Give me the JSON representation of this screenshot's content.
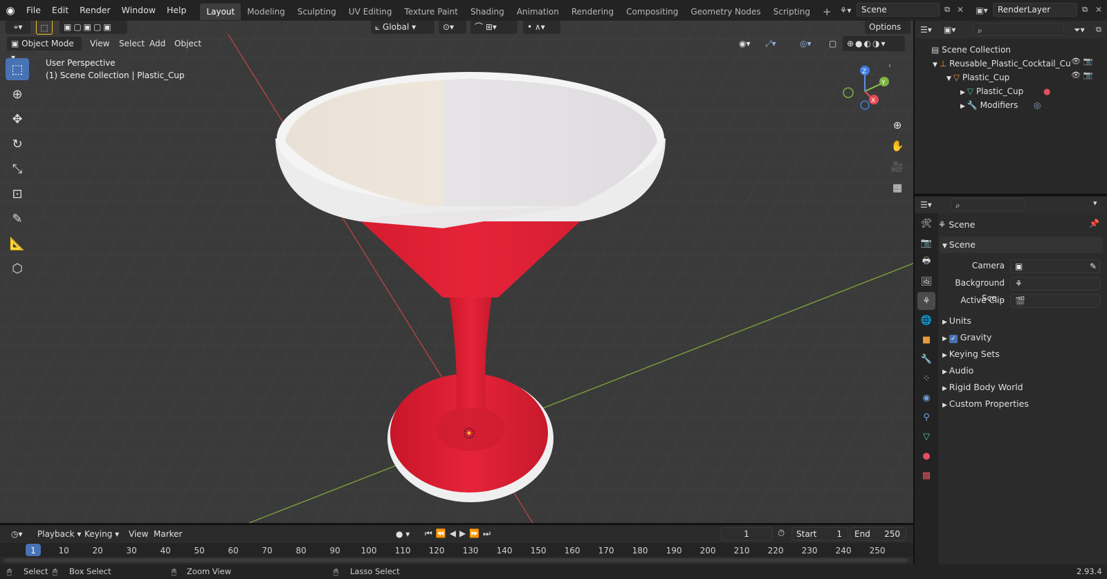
{
  "menubar": {
    "logo_icon": "blender-logo-icon",
    "items": [
      "File",
      "Edit",
      "Render",
      "Window",
      "Help"
    ]
  },
  "workspace_tabs": [
    "Layout",
    "Modeling",
    "Sculpting",
    "UV Editing",
    "Texture Paint",
    "Shading",
    "Animation",
    "Rendering",
    "Compositing",
    "Geometry Nodes",
    "Scripting"
  ],
  "active_workspace": "Layout",
  "add_tab_label": "+",
  "scene_selector": {
    "value": "Scene"
  },
  "viewlayer_selector": {
    "value": "RenderLayer"
  },
  "viewport": {
    "mode": "Object Mode",
    "menus": [
      "View",
      "Select",
      "Add",
      "Object"
    ],
    "transform_orientation": "Global",
    "options_label": "Options",
    "overlay_line1": "User Perspective",
    "overlay_line2": "(1) Scene Collection | Plastic_Cup",
    "gizmo_axes": [
      "Z",
      "Y",
      "X"
    ]
  },
  "outliner": {
    "root": "Scene Collection",
    "items": [
      {
        "label": "Reusable_Plastic_Cocktail_Cu",
        "level": 1
      },
      {
        "label": "Plastic_Cup",
        "level": 2
      },
      {
        "label": "Plastic_Cup",
        "level": 3
      },
      {
        "label": "Modifiers",
        "level": 3
      }
    ]
  },
  "properties": {
    "context_title": "Scene",
    "section_title": "Scene",
    "fields": [
      {
        "label": "Camera",
        "value": ""
      },
      {
        "label": "Background Sce...",
        "value": ""
      },
      {
        "label": "Active Clip",
        "value": ""
      }
    ],
    "panels": [
      "Units",
      "Gravity",
      "Keying Sets",
      "Audio",
      "Rigid Body World",
      "Custom Properties"
    ],
    "gravity_checked": true
  },
  "timeline": {
    "menus": [
      "Playback",
      "Keying",
      "View",
      "Marker"
    ],
    "current_frame": "1",
    "start_label": "Start",
    "start_value": "1",
    "end_label": "End",
    "end_value": "250",
    "ticks": [
      "1",
      "10",
      "20",
      "30",
      "40",
      "50",
      "60",
      "70",
      "80",
      "90",
      "100",
      "110",
      "120",
      "130",
      "140",
      "150",
      "160",
      "170",
      "180",
      "190",
      "200",
      "210",
      "220",
      "230",
      "240",
      "250"
    ]
  },
  "statusbar": {
    "select": "Select",
    "box_select": "Box Select",
    "zoom_view": "Zoom View",
    "lasso_select": "Lasso Select",
    "version": "2.93.4"
  },
  "colors": {
    "accent": "#4772b3",
    "cup_red": "#e21f37",
    "cup_white": "#ecebea",
    "grid_bg": "#3b3b3b",
    "x_axis": "#b83a3a",
    "y_axis": "#7ba23b"
  }
}
